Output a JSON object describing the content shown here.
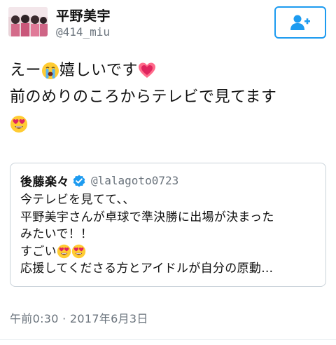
{
  "author": {
    "display_name": "平野美宇",
    "handle": "@414_miu"
  },
  "follow_button": {
    "icon": "add-user-icon",
    "color": "#1d9bf0"
  },
  "tweet": {
    "line1_a": "えー",
    "line1_b": "嬉しいです",
    "line2": "前のめりのころからテレビで見てます",
    "emoji_1": "crying-face-icon",
    "emoji_2": "heart-icon",
    "emoji_3": "heart-eyes-face-icon"
  },
  "quoted_tweet": {
    "display_name": "後藤楽々",
    "verified_icon": "verified-badge-icon",
    "handle": "@lalagoto0723",
    "line1": "今テレビを見てて、、",
    "line2": "平野美宇さんが卓球で準決勝に出場が決まった",
    "line3": "みたいで！！",
    "line4": "すごい",
    "line5": "応援してくださる方とアイドルが自分の原動…"
  },
  "timestamp": "午前0:30 · 2017年6月3日",
  "colors": {
    "accent": "#1d9bf0",
    "muted": "#6a737c",
    "border": "#c9d2d9"
  }
}
